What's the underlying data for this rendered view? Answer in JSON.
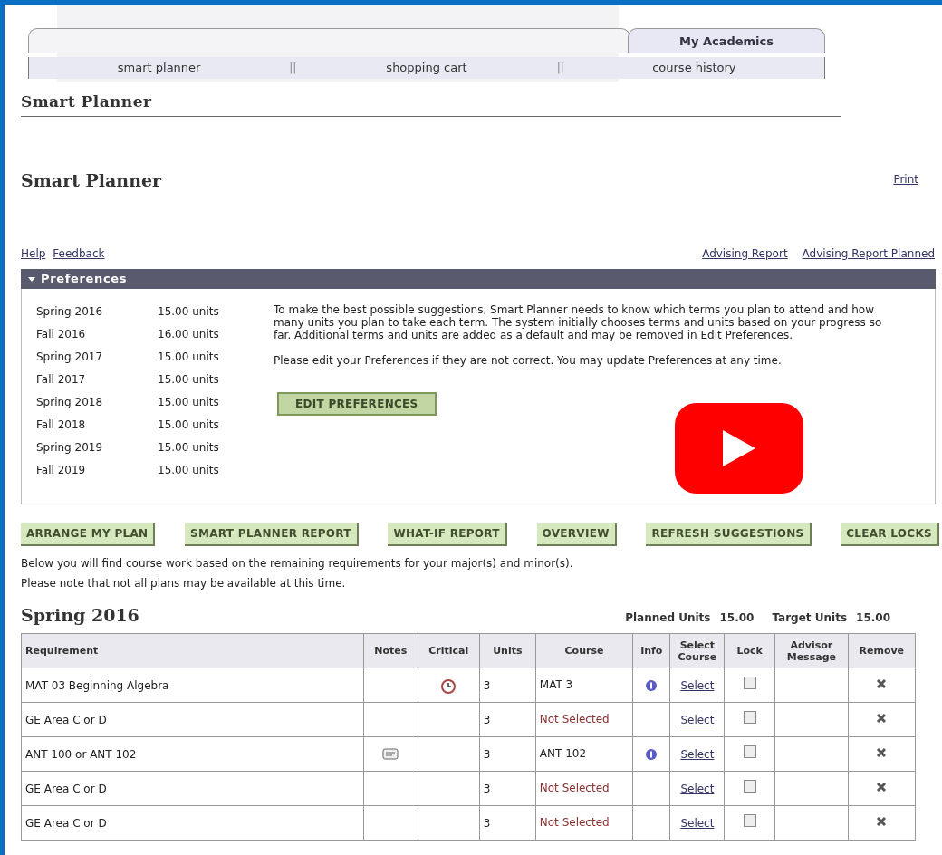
{
  "top_tab": {
    "label": "My Academics"
  },
  "sub_tabs": [
    "smart planner",
    "shopping cart",
    "course history"
  ],
  "sub_tab_separator": "||",
  "section_heading": "Smart Planner",
  "page_title": "Smart Planner",
  "print_link": "Print",
  "left_links": [
    "Help",
    "Feedback"
  ],
  "right_links": [
    "Advising Report",
    "Advising Report Planned"
  ],
  "preferences": {
    "title": "Preferences",
    "expanded": true,
    "terms": [
      {
        "term": "Spring 2016",
        "units": "15.00 units"
      },
      {
        "term": "Fall 2016",
        "units": "16.00 units"
      },
      {
        "term": "Spring 2017",
        "units": "15.00 units"
      },
      {
        "term": "Fall 2017",
        "units": "15.00 units"
      },
      {
        "term": "Spring 2018",
        "units": "15.00 units"
      },
      {
        "term": "Fall 2018",
        "units": "15.00 units"
      },
      {
        "term": "Spring 2019",
        "units": "15.00 units"
      },
      {
        "term": "Fall 2019",
        "units": "15.00 units"
      }
    ],
    "paragraphs": [
      "To make the best possible suggestions, Smart Planner needs to know which terms you plan to attend and how many units you plan to take each term. The system initially chooses terms and units based on your progress so far. Additional terms and units are added as a default and may be removed in Edit Preferences.",
      "Please edit your Preferences if they are not correct. You may update Preferences at any time."
    ],
    "button": "EDIT PREFERENCES"
  },
  "actions": [
    "ARRANGE MY PLAN",
    "SMART PLANNER REPORT",
    "WHAT-IF REPORT",
    "OVERVIEW",
    "REFRESH SUGGESTIONS",
    "CLEAR LOCKS"
  ],
  "notes": [
    "Below you will find course work based on the remaining requirements for your major(s) and minor(s).",
    "Please note that not all plans may be available at this time."
  ],
  "term": {
    "title": "Spring 2016",
    "planned_label": "Planned Units",
    "planned_value": "15.00",
    "target_label": "Target Units",
    "target_value": "15.00"
  },
  "table": {
    "columns": [
      "Requirement",
      "Notes",
      "Critical",
      "Units",
      "Course",
      "Info",
      "Select Course",
      "Lock",
      "Advisor Message",
      "Remove"
    ],
    "rows": [
      {
        "requirement": "MAT 03 Beginning Algebra",
        "has_note": false,
        "critical": true,
        "units": "3",
        "course": "MAT 3",
        "course_selected": true,
        "info": true,
        "select": "Select",
        "locked": false
      },
      {
        "requirement": "GE Area C or D",
        "has_note": false,
        "critical": false,
        "units": "3",
        "course": "Not Selected",
        "course_selected": false,
        "info": false,
        "select": "Select",
        "locked": false
      },
      {
        "requirement": "ANT 100 or ANT 102",
        "has_note": true,
        "critical": false,
        "units": "3",
        "course": "ANT 102",
        "course_selected": true,
        "info": true,
        "select": "Select",
        "locked": false
      },
      {
        "requirement": "GE Area C or D",
        "has_note": false,
        "critical": false,
        "units": "3",
        "course": "Not Selected",
        "course_selected": false,
        "info": false,
        "select": "Select",
        "locked": false
      },
      {
        "requirement": "GE Area C or D",
        "has_note": false,
        "critical": false,
        "units": "3",
        "course": "Not Selected",
        "course_selected": false,
        "info": false,
        "select": "Select",
        "locked": false
      }
    ]
  },
  "video_overlay": {
    "kind": "play"
  }
}
